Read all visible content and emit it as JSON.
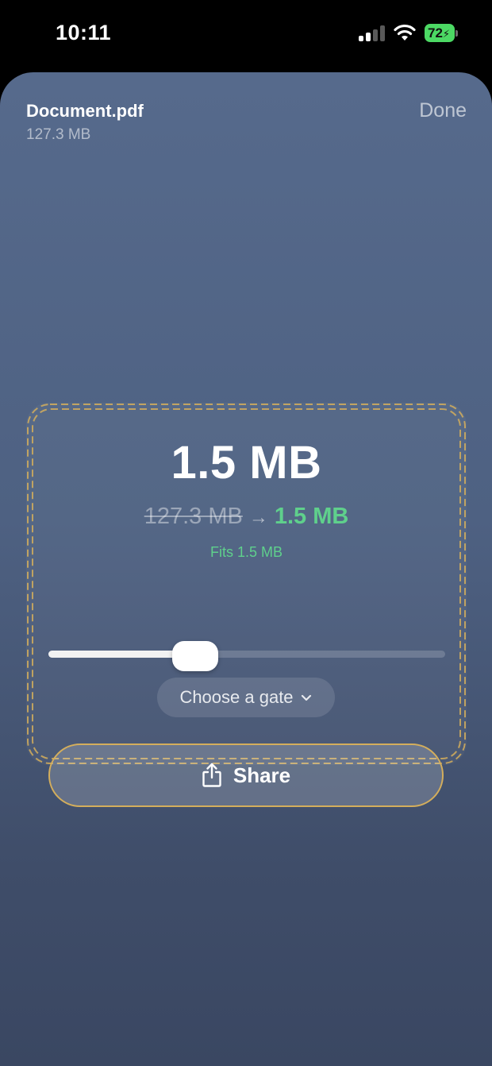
{
  "status_bar": {
    "time": "10:11",
    "battery": "72",
    "icons": [
      "signal-icon",
      "wifi-icon",
      "battery-icon"
    ]
  },
  "header": {
    "file_name": "Document.pdf",
    "file_size": "127.3 MB",
    "done_label": "Done"
  },
  "compression": {
    "target_size": "1.5 MB",
    "original_size": "127.3 MB",
    "arrow": "→",
    "result_size": "1.5 MB",
    "fits_label": "Fits 1.5 MB",
    "slider_level": 0.37
  },
  "gate_select": {
    "label": "Choose a gate",
    "icon": "chevron-down-icon"
  },
  "share": {
    "label": "Share",
    "icon": "share-icon"
  },
  "colors": {
    "accent_green": "#5fd08c",
    "highlight_border": "#d4ae5c",
    "battery_green": "#4cd964"
  }
}
